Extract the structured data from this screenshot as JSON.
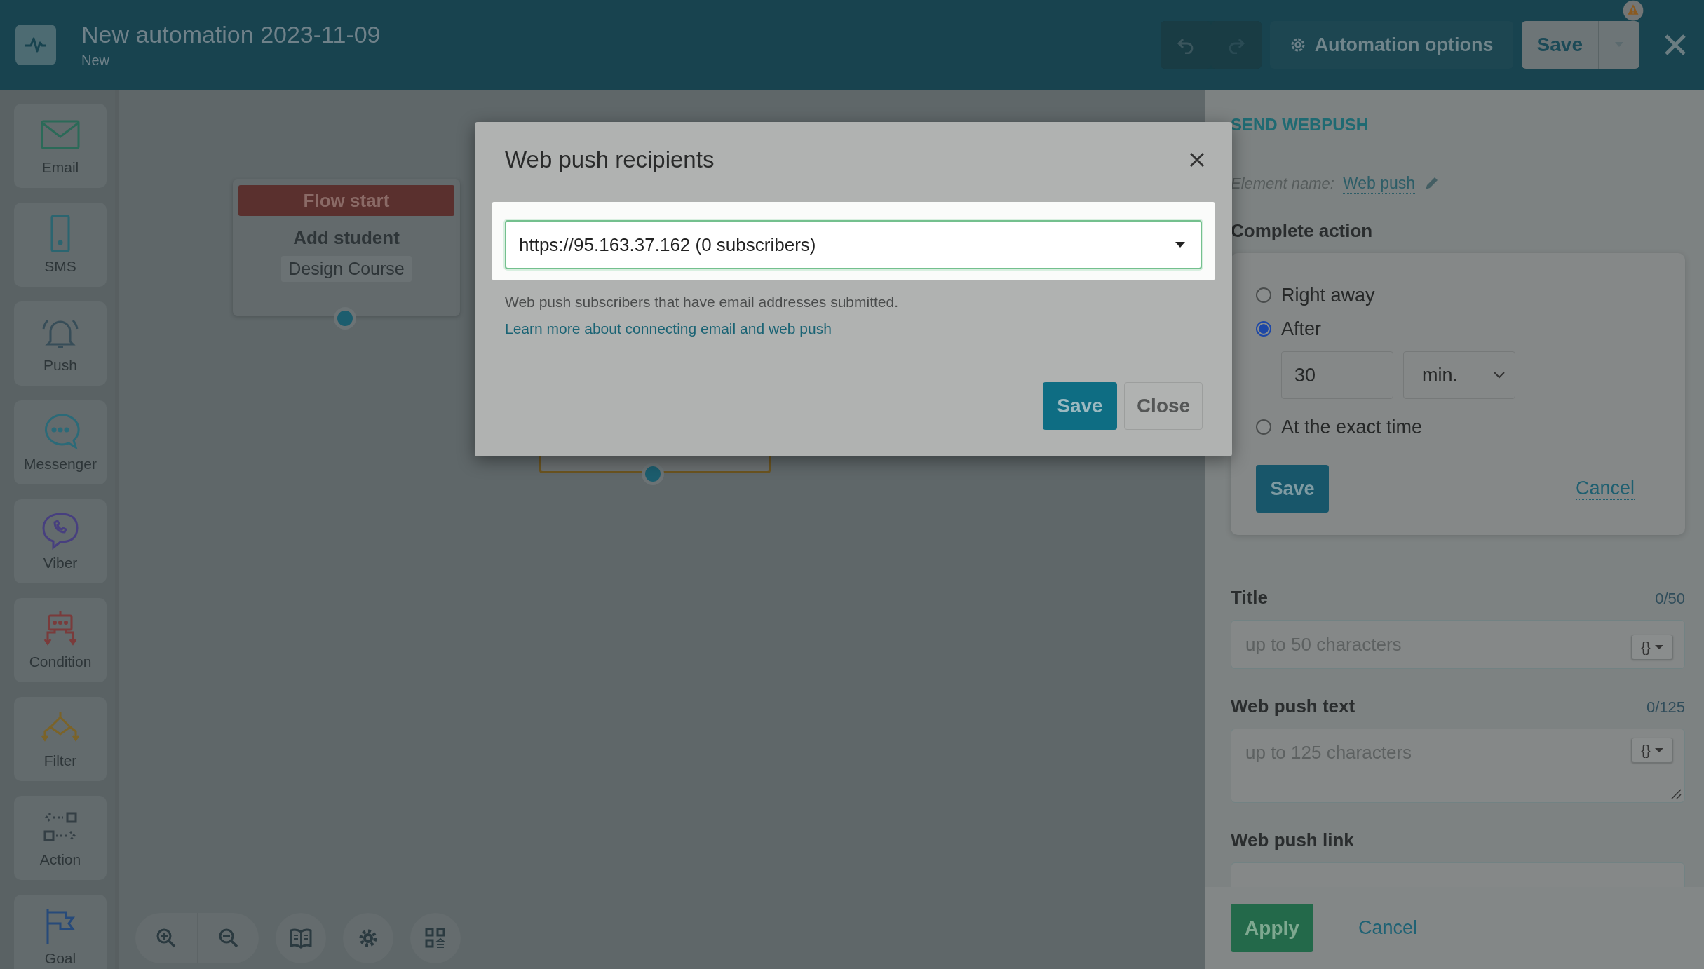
{
  "header": {
    "title": "New automation 2023-11-09",
    "subtitle": "New",
    "options_button": "Automation options",
    "save_button": "Save"
  },
  "palette": [
    {
      "kind": "email",
      "label": "Email"
    },
    {
      "kind": "sms",
      "label": "SMS"
    },
    {
      "kind": "push",
      "label": "Push"
    },
    {
      "kind": "messenger",
      "label": "Messenger"
    },
    {
      "kind": "viber",
      "label": "Viber"
    },
    {
      "kind": "condition",
      "label": "Condition"
    },
    {
      "kind": "filter",
      "label": "Filter"
    },
    {
      "kind": "action",
      "label": "Action"
    },
    {
      "kind": "goal",
      "label": "Goal"
    }
  ],
  "canvas": {
    "start_node": {
      "header": "Flow start",
      "title": "Add student",
      "tag": "Design Course"
    }
  },
  "modal": {
    "title": "Web push recipients",
    "select_value": "https://95.163.37.162 (0 subscribers)",
    "help_text": "Web push subscribers that have email addresses submitted.",
    "help_link": "Learn more about connecting email and web push",
    "save_button": "Save",
    "close_button": "Close"
  },
  "panel": {
    "heading": "SEND WEBPUSH",
    "element_name_label": "Element name:",
    "element_name": "Web push",
    "complete_action": {
      "label": "Complete action",
      "options": [
        {
          "label": "Right away",
          "selected": false
        },
        {
          "label": "After",
          "selected": true,
          "delay": {
            "value": "30",
            "unit": "min."
          }
        },
        {
          "label": "At the exact time",
          "selected": false
        }
      ],
      "save_button": "Save",
      "cancel_link": "Cancel"
    },
    "fields": [
      {
        "kind": "input",
        "label": "Title",
        "counter": "0/50",
        "placeholder": "up to 50 characters",
        "variables_button": "{}"
      },
      {
        "kind": "textarea",
        "label": "Web push text",
        "counter": "0/125",
        "placeholder": "up to 125 characters",
        "variables_button": "{}"
      },
      {
        "kind": "cut",
        "label": "Web push link"
      }
    ]
  },
  "footer": {
    "apply_button": "Apply",
    "cancel_link": "Cancel"
  }
}
